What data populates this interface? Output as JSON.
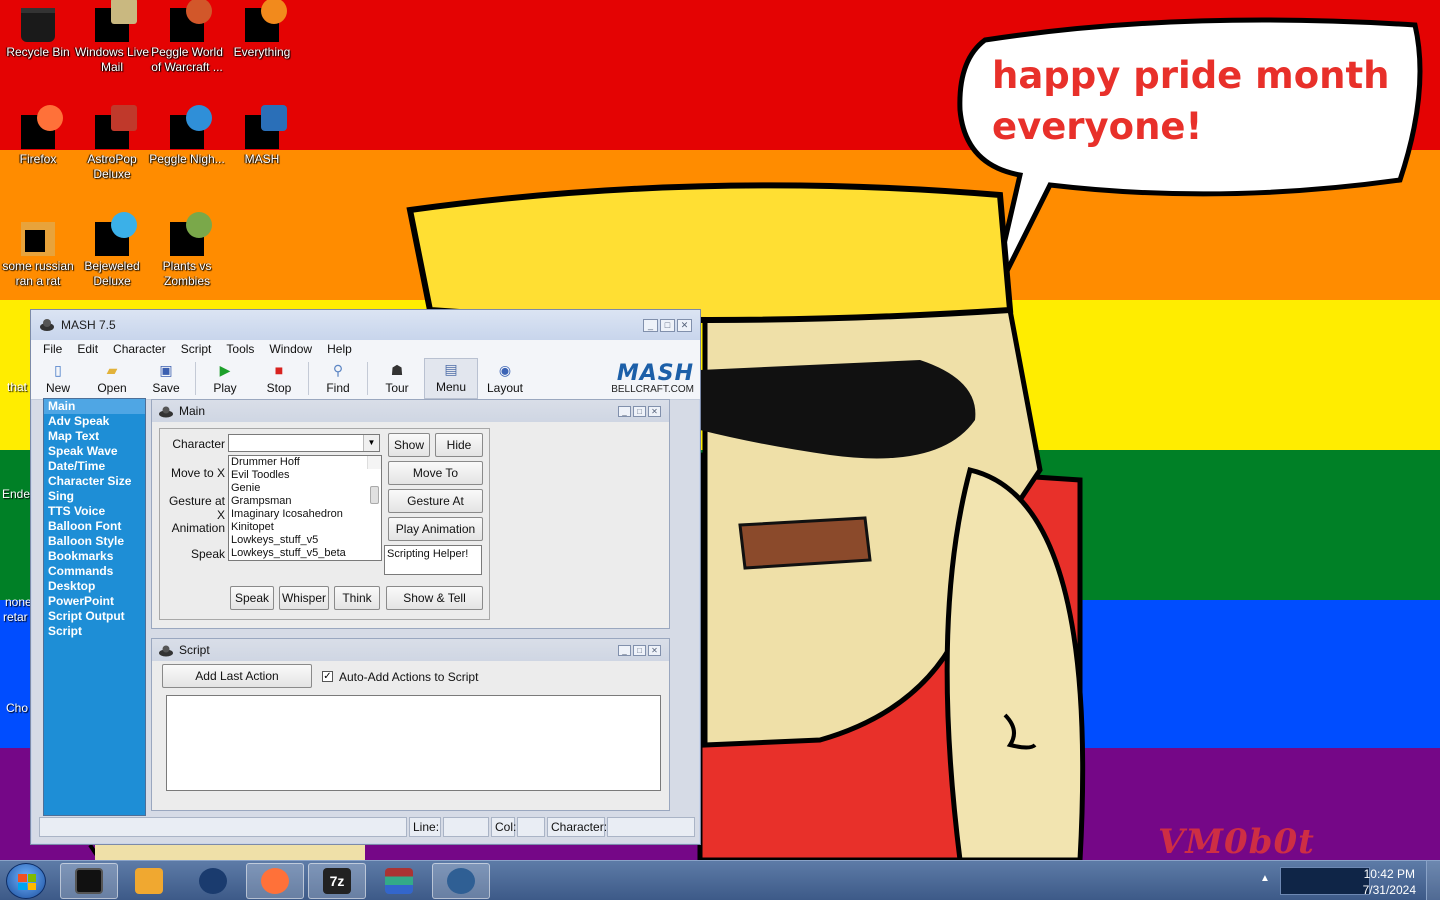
{
  "wallpaper": {
    "stripes": [
      "#e40303",
      "#ff8c00",
      "#ffed00",
      "#008026",
      "#004dff",
      "#750787"
    ],
    "speech_bubble": "happy pride month everyone!",
    "signature": "VM0b0t"
  },
  "desktop_icons": [
    {
      "label": "Recycle Bin",
      "icon": "recycle-bin-icon"
    },
    {
      "label": "Windows Live Mail",
      "icon": "mail-icon"
    },
    {
      "label": "Peggle World of Warcraft ...",
      "icon": "peggle-wow-icon"
    },
    {
      "label": "Everything",
      "icon": "search-icon"
    },
    {
      "label": "Firefox",
      "icon": "firefox-icon"
    },
    {
      "label": "AstroPop Deluxe",
      "icon": "astropop-icon"
    },
    {
      "label": "Peggle Nigh...",
      "icon": "peggle-nights-icon"
    },
    {
      "label": "MASH",
      "icon": "mash-icon"
    },
    {
      "label": "some russian ran a rat",
      "icon": "shortcut-icon"
    },
    {
      "label": "Bejeweled Deluxe",
      "icon": "bejeweled-icon"
    },
    {
      "label": "Plants vs Zombies",
      "icon": "pvz-icon"
    }
  ],
  "partial_icons": [
    "that",
    "Ende",
    "none",
    "retar",
    "Cho"
  ],
  "mash": {
    "title": "MASH 7.5",
    "menu": [
      "File",
      "Edit",
      "Character",
      "Script",
      "Tools",
      "Window",
      "Help"
    ],
    "toolbar": [
      {
        "label": "New",
        "icon": "new-file-icon"
      },
      {
        "label": "Open",
        "icon": "open-folder-icon"
      },
      {
        "label": "Save",
        "icon": "save-icon"
      },
      {
        "label": "Play",
        "icon": "play-icon"
      },
      {
        "label": "Stop",
        "icon": "stop-icon"
      },
      {
        "label": "Find",
        "icon": "find-icon"
      },
      {
        "label": "Tour",
        "icon": "tour-icon"
      },
      {
        "label": "Menu",
        "icon": "menu-icon"
      },
      {
        "label": "Layout",
        "icon": "layout-icon"
      }
    ],
    "logo": {
      "main": "MASH",
      "sub": "BELLCRAFT.COM"
    },
    "sidebar": [
      "Main",
      "Adv Speak",
      "Map Text",
      "Speak Wave",
      "Date/Time",
      "Character Size",
      "Sing",
      "TTS Voice",
      "Balloon Font",
      "Balloon Style",
      "Bookmarks",
      "Commands",
      "Desktop",
      "PowerPoint",
      "Script Output",
      "Script"
    ],
    "sidebar_active": "Main",
    "main_panel": {
      "title": "Main",
      "labels": {
        "character": "Character",
        "move_to": "Move to X",
        "gesture_at": "Gesture at X",
        "animation": "Animation",
        "speak": "Speak"
      },
      "character_value": "",
      "animations": [
        "Drummer Hoff",
        "Evil Toodles",
        "Genie",
        "Grampsman",
        "Imaginary Icosahedron",
        "Kinitopet",
        "Lowkeys_stuff_v5",
        "Lowkeys_stuff_v5_beta"
      ],
      "buttons": {
        "show": "Show",
        "hide": "Hide",
        "move_to": "Move To",
        "gesture_at": "Gesture At",
        "play_animation": "Play Animation",
        "speak": "Speak",
        "whisper": "Whisper",
        "think": "Think",
        "show_tell": "Show & Tell"
      },
      "speak_text": "Scripting Helper!"
    },
    "script_panel": {
      "title": "Script",
      "add_last_action": "Add Last Action",
      "auto_add_label": "Auto-Add Actions to Script",
      "auto_add_checked": true,
      "script_text": ""
    },
    "status": {
      "line_label": "Line:",
      "line_value": "",
      "col_label": "Col:",
      "col_value": "",
      "character_label": "Character:",
      "character_value": ""
    }
  },
  "taskbar": {
    "items": [
      "explorer-icon",
      "media-player-icon",
      "globe-icon",
      "firefox-icon",
      "7zip-icon",
      "winrar-icon",
      "mash-icon"
    ],
    "open_items": [
      "firefox-icon",
      "7zip-icon",
      "mash-icon"
    ],
    "time": "10:42 PM",
    "date": "7/31/2024"
  }
}
